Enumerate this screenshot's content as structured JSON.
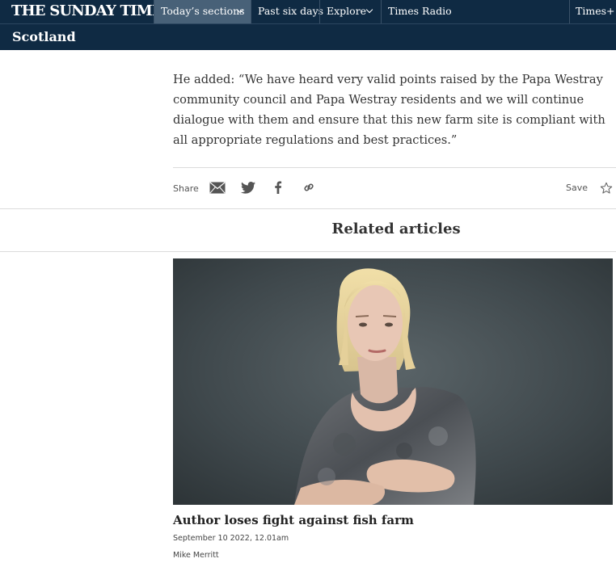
{
  "header": {
    "logo": "THE SUNDAY TIMES",
    "nav": {
      "todays_sections": "Today’s sections",
      "past_six_days": "Past six days",
      "explore": "Explore",
      "times_radio": "Times Radio",
      "times_plus": "Times+"
    },
    "section": "Scotland"
  },
  "article": {
    "paragraph": "He added: “We have heard very valid points raised by the Papa Westray community council and Papa Westray residents and we will continue dialogue with them and ensure that this new farm site is compliant with all appropriate regulations and best practices.”"
  },
  "share_bar": {
    "share_label": "Share",
    "save_label": "Save",
    "icons": [
      "email-icon",
      "twitter-icon",
      "facebook-icon",
      "link-icon",
      "star-icon"
    ]
  },
  "related": {
    "heading": "Related articles",
    "items": [
      {
        "headline": "Author loses fight against fish farm",
        "date": "September 10 2022, 12.01am",
        "author": "Mike Merritt"
      }
    ]
  },
  "colors": {
    "nav_bg": "#0f2a43",
    "nav_active": "#486178",
    "divider": "#dcdcdc"
  }
}
